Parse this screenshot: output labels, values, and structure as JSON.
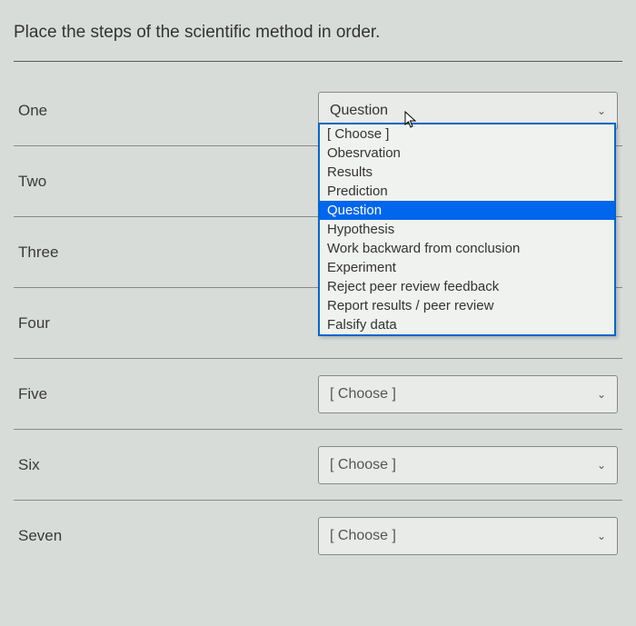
{
  "prompt": "Place the steps of the scientific method in order.",
  "rows": [
    {
      "label": "One",
      "selected": "Question",
      "open": true
    },
    {
      "label": "Two",
      "selected": null
    },
    {
      "label": "Three",
      "selected": null
    },
    {
      "label": "Four",
      "selected": null
    },
    {
      "label": "Five",
      "selected": "[ Choose ]"
    },
    {
      "label": "Six",
      "selected": "[ Choose ]"
    },
    {
      "label": "Seven",
      "selected": "[ Choose ]"
    }
  ],
  "choose_placeholder": "[ Choose ]",
  "dropdown_options": [
    "[ Choose ]",
    "Obesrvation",
    "Results",
    "Prediction",
    "Question",
    "Hypothesis",
    "Work backward from conclusion",
    "Experiment",
    "Reject peer review feedback",
    "Report results / peer review",
    "Falsify data"
  ],
  "highlighted_option_index": 4
}
